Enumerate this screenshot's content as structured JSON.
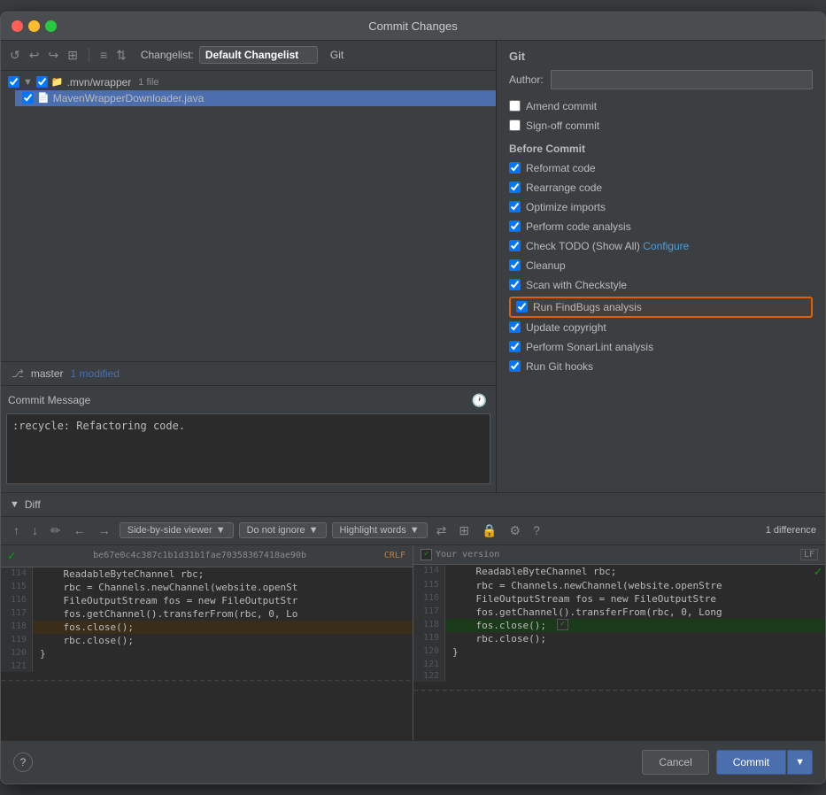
{
  "window": {
    "title": "Commit Changes"
  },
  "toolbar": {
    "changelist_label": "Changelist:",
    "changelist_value": "Default Changelist",
    "git_label": "Git"
  },
  "file_tree": {
    "root_label": ".mvn/wrapper",
    "root_file_count": "1 file",
    "file_name": "MavenWrapperDownloader.java"
  },
  "status": {
    "branch": "master",
    "modified": "1 modified"
  },
  "commit_message": {
    "label": "Commit Message",
    "value": ":recycle: Refactoring code."
  },
  "git_panel": {
    "title": "Git",
    "author_label": "Author:",
    "author_placeholder": "",
    "checkboxes": {
      "amend_commit": {
        "label": "Amend commit",
        "checked": false
      },
      "sign_off_commit": {
        "label": "Sign-off commit",
        "checked": false
      }
    },
    "before_commit_title": "Before Commit",
    "before_commit_items": [
      {
        "label": "Reformat code",
        "checked": true
      },
      {
        "label": "Rearrange code",
        "checked": true
      },
      {
        "label": "Optimize imports",
        "checked": true
      },
      {
        "label": "Perform code analysis",
        "checked": true
      },
      {
        "label": "Check TODO (Show All)",
        "checked": true,
        "has_link": true,
        "link_text": "Configure"
      },
      {
        "label": "Cleanup",
        "checked": true
      },
      {
        "label": "Scan with Checkstyle",
        "checked": true
      },
      {
        "label": "Run FindBugs analysis",
        "checked": true,
        "highlighted": true
      },
      {
        "label": "Update copyright",
        "checked": true
      },
      {
        "label": "Perform SonarLint analysis",
        "checked": true
      },
      {
        "label": "Run Git hooks",
        "checked": true
      }
    ]
  },
  "diff_section": {
    "title": "Diff",
    "toolbar": {
      "up_label": "↑",
      "down_label": "↓",
      "viewer_label": "Side-by-side viewer",
      "ignore_label": "Do not ignore",
      "highlight_label": "Highlight words",
      "diff_count": "1 difference"
    },
    "left_file": {
      "hash": "be67e0c4c387c1b1d31b1fae70358367418ae90b",
      "line_ending": "CRLF"
    },
    "right_file": {
      "label": "Your version",
      "line_ending": "LF"
    },
    "lines": [
      {
        "num": "114",
        "content_left": "    ReadableByteChannel rbc;",
        "content_right": "    ReadableByteChannel rbc;"
      },
      {
        "num": "115",
        "content_left": "    rbc = Channels.newChannel(website.openSt",
        "content_right": "    rbc = Channels.newChannel(website.openStre"
      },
      {
        "num": "116",
        "content_left": "    FileOutputStream fos = new FileOutputStr",
        "content_right": "    FileOutputStream fos = new FileOutputStre"
      },
      {
        "num": "117",
        "content_left": "    fos.getChannel().transferFrom(rbc, 0, Lo",
        "content_right": "    fos.getChannel().transferFrom(rbc, 0, Long"
      },
      {
        "num": "118",
        "content_left": "    fos.close();",
        "content_right": "    fos.close();",
        "modified": true
      },
      {
        "num": "119",
        "content_left": "    rbc.close();",
        "content_right": "    rbc.close();"
      },
      {
        "num": "120",
        "content_left": "}",
        "content_right": "}"
      },
      {
        "num": "121",
        "content_left": "",
        "content_right": ""
      },
      {
        "num": "122",
        "content_left": "",
        "content_right": ""
      }
    ]
  },
  "bottom_bar": {
    "help": "?",
    "cancel": "Cancel",
    "commit": "Commit"
  }
}
